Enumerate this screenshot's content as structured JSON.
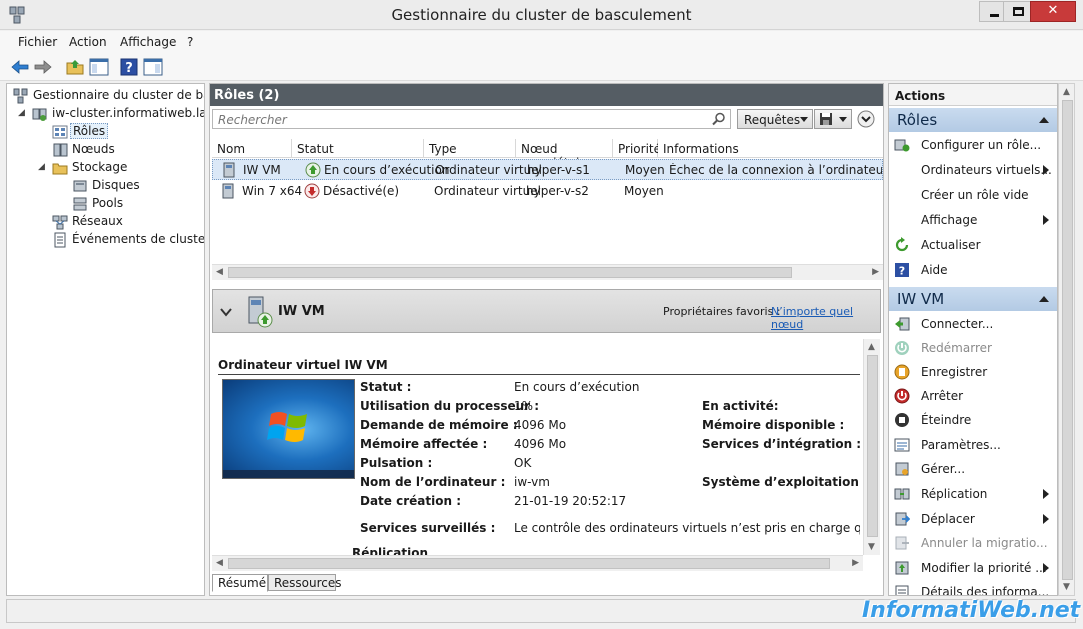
{
  "window": {
    "title": "Gestionnaire du cluster de basculement",
    "min_glyph": "",
    "max_glyph": "",
    "close_glyph": "✕"
  },
  "menu": {
    "file": "Fichier",
    "action": "Action",
    "view": "Affichage",
    "help": "?"
  },
  "tree": {
    "root": "Gestionnaire du cluster de basculement",
    "cluster": "iw-cluster.informatiweb.lan",
    "roles": "Rôles",
    "nodes": "Nœuds",
    "storage": "Stockage",
    "disks": "Disques",
    "pools": "Pools",
    "networks": "Réseaux",
    "events": "Événements de cluster"
  },
  "center": {
    "header": "Rôles (2)",
    "search_placeholder": "Rechercher",
    "queries_label": "Requêtes",
    "columns": [
      "Nom",
      "Statut",
      "Type",
      "Nœud propriétaire",
      "Priorité",
      "Informations"
    ],
    "rows": [
      {
        "name": "IW VM",
        "status": "En cours d’exécution",
        "type": "Ordinateur virtuel",
        "owner": "hyper-v-s1",
        "priority": "Moyen",
        "info": "Échec de la connexion à l’ordinateur virtuel ..."
      },
      {
        "name": "Win 7 x64",
        "status": "Désactivé(e)",
        "type": "Ordinateur virtuel",
        "owner": "hyper-v-s2",
        "priority": "Moyen",
        "info": ""
      }
    ]
  },
  "detail": {
    "vm_name": "IW VM",
    "favorites_label": "Propriétaires favoris :",
    "favorites_link": "N’importe quel nœud",
    "section_title": "Ordinateur virtuel IW VM",
    "left_fields": [
      {
        "label": "Statut :",
        "value": "En cours d’exécution"
      },
      {
        "label": "Utilisation du processeur :",
        "value": "1%"
      },
      {
        "label": "Demande de mémoire :",
        "value": "4096 Mo"
      },
      {
        "label": "Mémoire affectée :",
        "value": "4096 Mo"
      },
      {
        "label": "Pulsation :",
        "value": "OK"
      },
      {
        "label": "Nom de l’ordinateur :",
        "value": "iw-vm"
      },
      {
        "label": "Date création :",
        "value": "21-01-19 20:52:17"
      }
    ],
    "right_fields": [
      "En activité:",
      "Mémoire disponible :",
      "Services d’intégration :",
      "Système d’exploitation :"
    ],
    "monitored_label": "Services surveillés :",
    "monitored_value": "Le contrôle des ordinateurs virtuels n’est pris en charge que sur les systèm",
    "replication_partial": "Réplication",
    "tabs": [
      "Résumé",
      "Ressources"
    ]
  },
  "actions": {
    "title": "Actions",
    "roles_section": "Rôles",
    "roles_items": [
      "Configurer un rôle...",
      "Ordinateurs virtuels...",
      "Créer un rôle vide",
      "Affichage",
      "Actualiser",
      "Aide"
    ],
    "vm_section": "IW VM",
    "vm_items": [
      "Connecter...",
      "Redémarrer",
      "Enregistrer",
      "Arrêter",
      "Éteindre",
      "Paramètres...",
      "Gérer...",
      "Réplication",
      "Déplacer",
      "Annuler la migratio...",
      "Modifier la priorité ...",
      "Détails des informa..."
    ]
  },
  "watermark": "InformatiWeb.net",
  "colors": {
    "section_header": "#555d64",
    "action_section": "#c9dbef",
    "link": "#1a5bb5",
    "selection": "#dbe8f7"
  }
}
